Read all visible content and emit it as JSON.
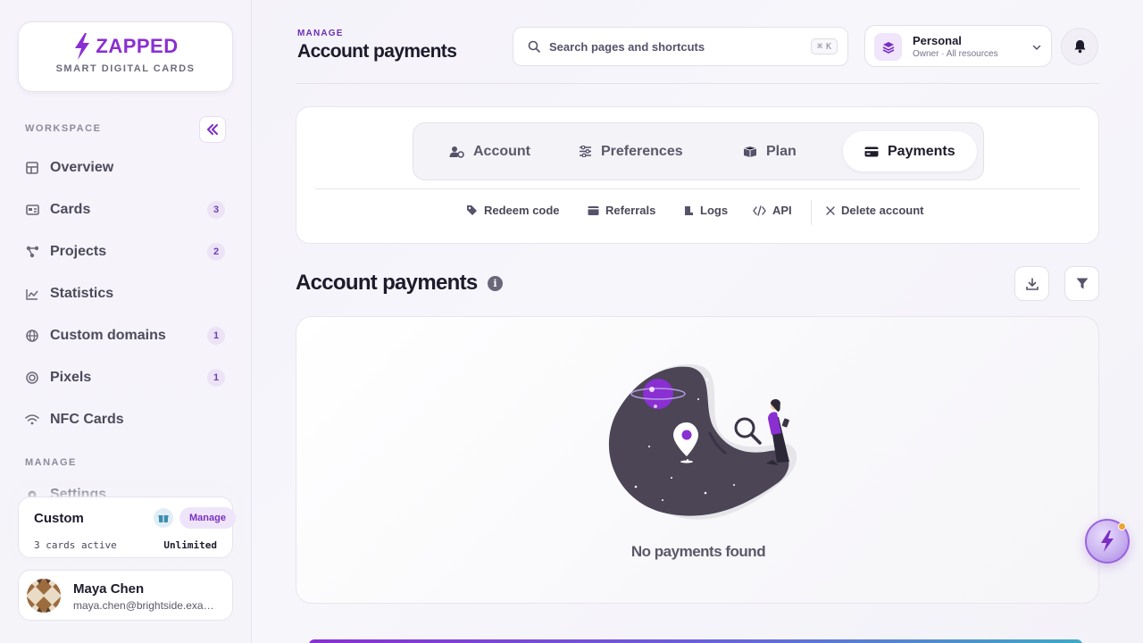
{
  "brand": {
    "name": "ZAPPED",
    "tagline": "SMART DIGITAL CARDS",
    "accent": "#8a2fd1"
  },
  "sidebar": {
    "workspace_label": "WORKSPACE",
    "manage_label": "MANAGE",
    "items": [
      {
        "label": "Overview",
        "icon": "grid-icon",
        "badge": null
      },
      {
        "label": "Cards",
        "icon": "id-card-icon",
        "badge": "3"
      },
      {
        "label": "Projects",
        "icon": "nodes-icon",
        "badge": "2"
      },
      {
        "label": "Statistics",
        "icon": "line-chart-icon",
        "badge": null
      },
      {
        "label": "Custom domains",
        "icon": "globe-icon",
        "badge": "1"
      },
      {
        "label": "Pixels",
        "icon": "target-icon",
        "badge": "1"
      },
      {
        "label": "NFC Cards",
        "icon": "wifi-icon",
        "badge": null
      }
    ],
    "manage_items": [
      {
        "label": "Settings",
        "icon": "gear-icon"
      }
    ],
    "plan": {
      "name": "Custom",
      "manage_label": "Manage",
      "active_text": "3 cards active",
      "limit_text": "Unlimited"
    },
    "user": {
      "name": "Maya Chen",
      "email": "maya.chen@brightside.example.com"
    }
  },
  "header": {
    "eyebrow": "MANAGE",
    "title": "Account payments",
    "search": {
      "placeholder": "Search pages and shortcuts",
      "shortcut_symbol": "⌘",
      "shortcut_key": "K"
    },
    "workspace": {
      "name": "Personal",
      "sub": "Owner · All resources"
    }
  },
  "tabs": [
    {
      "label": "Account",
      "icon": "user-gear-icon",
      "active": false
    },
    {
      "label": "Preferences",
      "icon": "sliders-icon",
      "active": false
    },
    {
      "label": "Plan",
      "icon": "box-icon",
      "active": false
    },
    {
      "label": "Payments",
      "icon": "credit-card-icon",
      "active": true
    }
  ],
  "sublinks": [
    {
      "label": "Redeem code",
      "icon": "tag-icon"
    },
    {
      "label": "Referrals",
      "icon": "wallet-icon"
    },
    {
      "label": "Logs",
      "icon": "scroll-icon"
    },
    {
      "label": "API",
      "icon": "code-icon"
    },
    {
      "label": "Delete account",
      "icon": "close-icon"
    }
  ],
  "section": {
    "title": "Account payments"
  },
  "empty_state": {
    "text": "No payments found"
  }
}
